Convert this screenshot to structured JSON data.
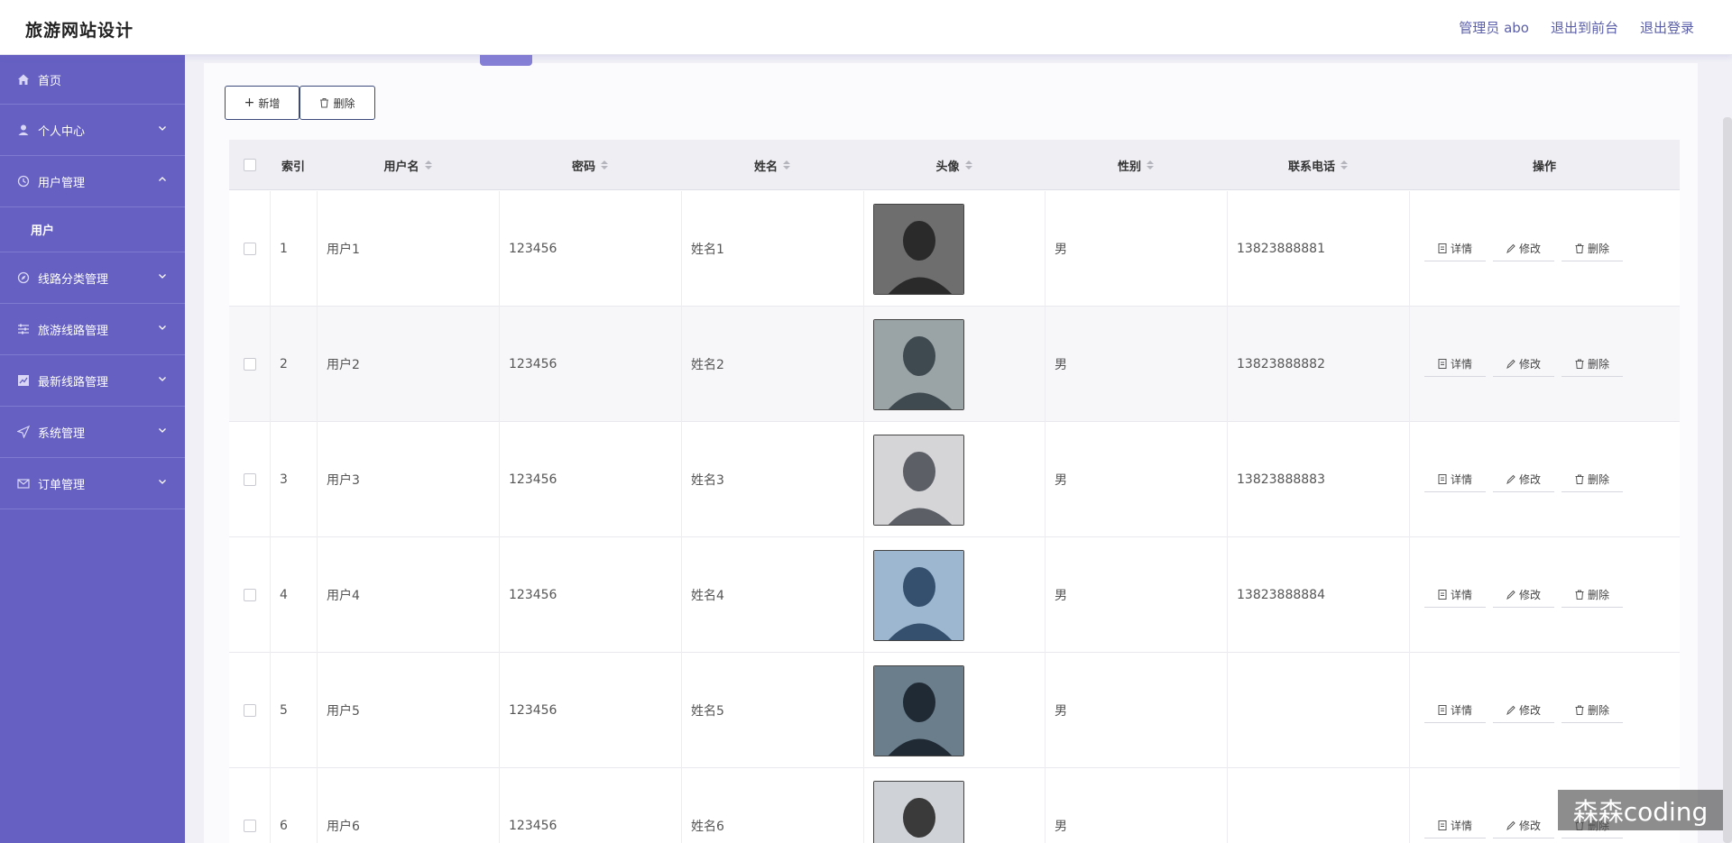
{
  "header": {
    "title": "旅游网站设计",
    "admin": "管理员 abo",
    "to_front": "退出到前台",
    "logout": "退出登录"
  },
  "sidebar": {
    "items": [
      {
        "label": "首页",
        "icon": "home-icon"
      },
      {
        "label": "个人中心",
        "icon": "user-icon"
      },
      {
        "label": "用户管理",
        "icon": "clock-icon",
        "expanded": true,
        "children": [
          {
            "label": "用户"
          }
        ]
      },
      {
        "label": "线路分类管理",
        "icon": "compass-icon"
      },
      {
        "label": "旅游线路管理",
        "icon": "sliders-icon"
      },
      {
        "label": "最新线路管理",
        "icon": "chart-icon"
      },
      {
        "label": "系统管理",
        "icon": "send-icon"
      },
      {
        "label": "订单管理",
        "icon": "mail-icon"
      }
    ]
  },
  "toolbar": {
    "add_label": "新增",
    "delete_label": "删除"
  },
  "table": {
    "headers": {
      "index": "索引",
      "username": "用户名",
      "password": "密码",
      "name": "姓名",
      "avatar": "头像",
      "gender": "性别",
      "phone": "联系电话",
      "actions": "操作"
    },
    "actions": {
      "detail": "详情",
      "edit": "修改",
      "delete": "删除"
    },
    "rows": [
      {
        "index": "1",
        "username": "用户1",
        "password": "123456",
        "name": "姓名1",
        "gender": "男",
        "phone": "13823888881"
      },
      {
        "index": "2",
        "username": "用户2",
        "password": "123456",
        "name": "姓名2",
        "gender": "男",
        "phone": "13823888882"
      },
      {
        "index": "3",
        "username": "用户3",
        "password": "123456",
        "name": "姓名3",
        "gender": "男",
        "phone": "13823888883"
      },
      {
        "index": "4",
        "username": "用户4",
        "password": "123456",
        "name": "姓名4",
        "gender": "男",
        "phone": "13823888884"
      },
      {
        "index": "5",
        "username": "用户5",
        "password": "123456",
        "name": "姓名5",
        "gender": "男",
        "phone": ""
      },
      {
        "index": "6",
        "username": "用户6",
        "password": "123456",
        "name": "姓名6",
        "gender": "男",
        "phone": ""
      }
    ]
  },
  "watermark": "森森coding",
  "colors": {
    "sidebar": "#6560c2",
    "header_link": "#5b5fa8"
  }
}
